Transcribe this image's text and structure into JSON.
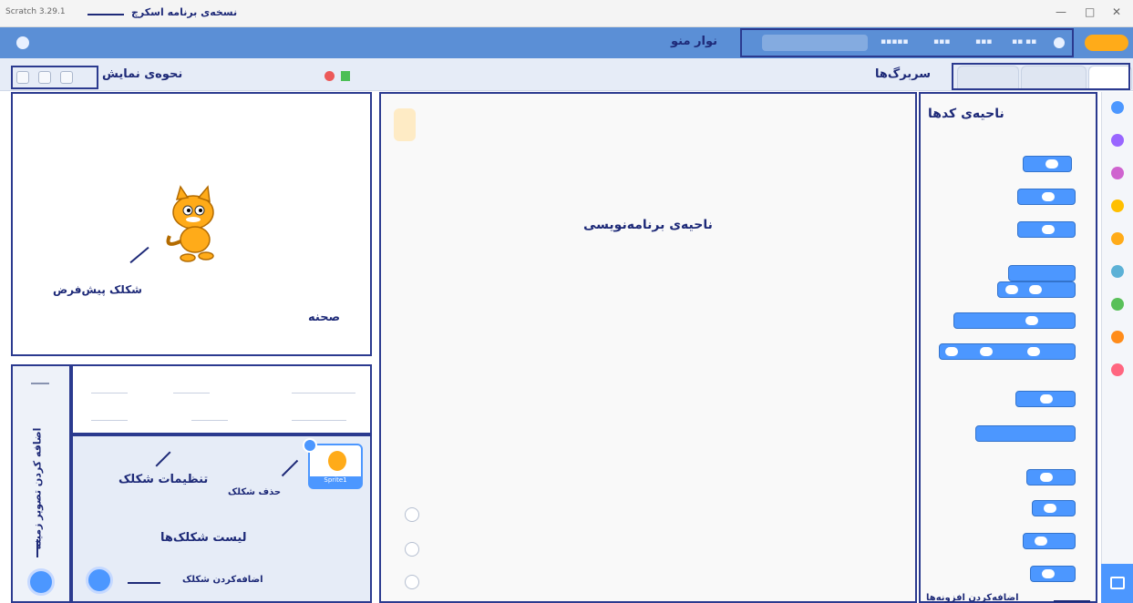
{
  "window": {
    "app_title": "Scratch 3.29.1",
    "title_annotation": "نسخه‌ی برنامه اسکرچ"
  },
  "menubar": {
    "annotation": "نوار منو"
  },
  "tabs": {
    "annotation": "سربرگ‌ها"
  },
  "stage_header": {
    "annotation": "نحوه‌ی نمایش"
  },
  "stage": {
    "label": "صحنه",
    "default_sprite_label": "شکلک پیش‌فرض"
  },
  "code_area": {
    "label": "ناحیه‌ی برنامه‌نویسی"
  },
  "palette": {
    "label": "ناحیه‌ی کدها"
  },
  "sprite_panel": {
    "settings_label": "تنظیمات شکلک",
    "delete_label": "حذف شکلک",
    "list_label": "لیست شکلک‌ها",
    "add_sprite_label": "اضافه‌کردن شکلک",
    "sprite_thumb_name": "Sprite1"
  },
  "backdrop_panel": {
    "add_backdrop_label": "اضافه کردن تصویر زمینه"
  },
  "extensions": {
    "label": "اضافه‌کردن افزونه‌ها"
  },
  "colors": {
    "annotation": "#1e2a78",
    "menubar": "#5b8fd6",
    "block_motion": "#4c97ff",
    "cat_motion": "#4c97ff",
    "cat_looks": "#9966ff",
    "cat_sound": "#cf63cf",
    "cat_events": "#ffbf00",
    "cat_control": "#ffab19",
    "cat_sensing": "#5cb1d6",
    "cat_operators": "#59c059",
    "cat_variables": "#ff8c1a",
    "cat_myblocks": "#ff6680"
  }
}
